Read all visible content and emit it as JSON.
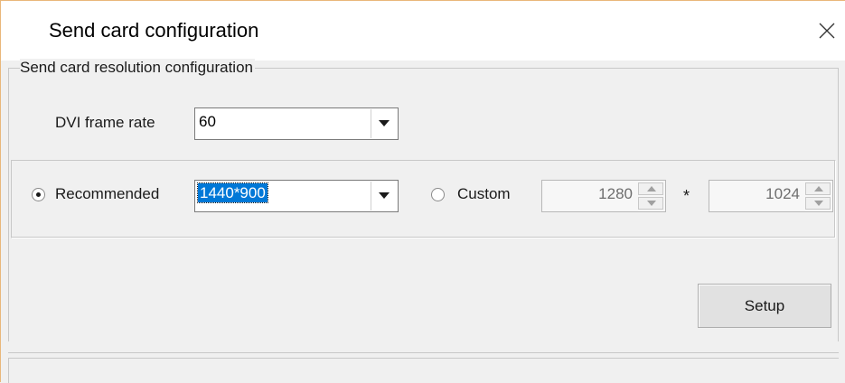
{
  "window": {
    "title": "Send card configuration"
  },
  "group": {
    "title": "Send card resolution configuration"
  },
  "dvi": {
    "label": "DVI frame rate",
    "value": "60"
  },
  "resolution": {
    "recommended_label": "Recommended",
    "recommended_selected": true,
    "recommended_value": "1440*900",
    "custom_label": "Custom",
    "custom_selected": false,
    "width": "1280",
    "separator": "*",
    "height": "1024"
  },
  "actions": {
    "setup_label": "Setup"
  },
  "icons": {
    "close": "close-icon",
    "dropdown": "chevron-down-icon",
    "spin_up": "spin-up-icon",
    "spin_down": "spin-down-icon"
  },
  "colors": {
    "selection": "#0078d7",
    "window_border": "#e9b77a"
  }
}
